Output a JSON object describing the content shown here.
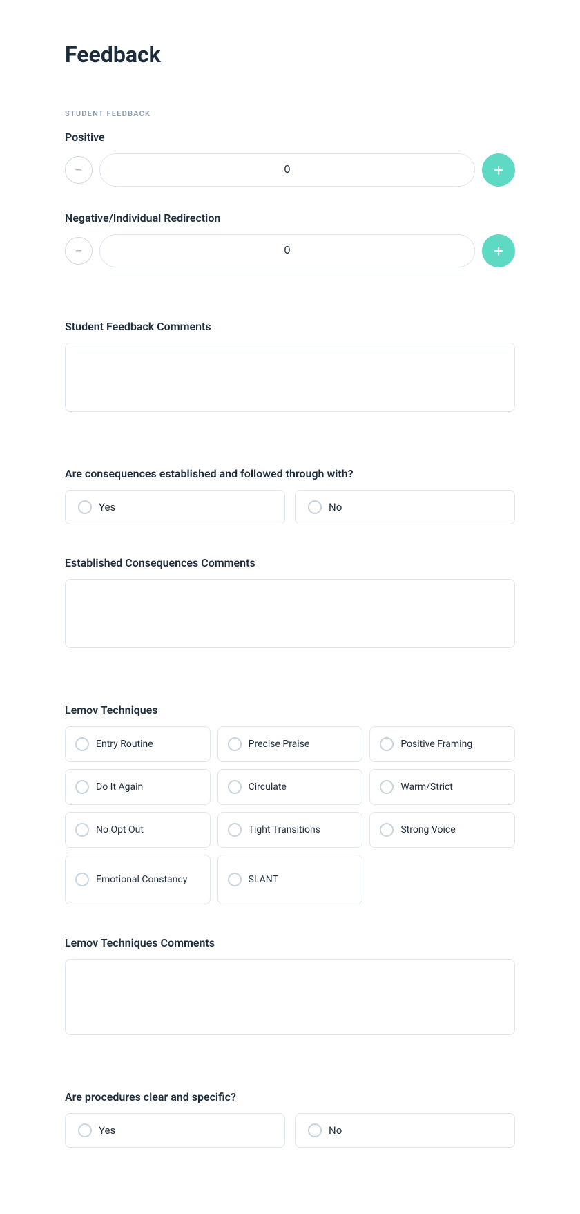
{
  "page": {
    "title": "Feedback"
  },
  "student_feedback_section": {
    "label": "STUDENT FEEDBACK",
    "positive": {
      "label": "Positive",
      "value": "0"
    },
    "negative": {
      "label": "Negative/Individual Redirection",
      "value": "0"
    },
    "comments": {
      "label": "Student Feedback Comments",
      "placeholder": ""
    }
  },
  "consequences_section": {
    "question": "Are consequences established and followed through with?",
    "yes_label": "Yes",
    "no_label": "No",
    "comments_label": "Established Consequences Comments",
    "comments_placeholder": ""
  },
  "lemov_section": {
    "label": "Lemov Techniques",
    "techniques": [
      {
        "id": "entry-routine",
        "label": "Entry Routine"
      },
      {
        "id": "precise-praise",
        "label": "Precise Praise"
      },
      {
        "id": "positive-framing",
        "label": "Positive Framing"
      },
      {
        "id": "do-it-again",
        "label": "Do It Again"
      },
      {
        "id": "circulate",
        "label": "Circulate"
      },
      {
        "id": "warm-strict",
        "label": "Warm/Strict"
      },
      {
        "id": "no-opt-out",
        "label": "No Opt Out"
      },
      {
        "id": "tight-transitions",
        "label": "Tight Transitions"
      },
      {
        "id": "strong-voice",
        "label": "Strong Voice"
      },
      {
        "id": "emotional-constancy",
        "label": "Emotional Constancy"
      },
      {
        "id": "slant",
        "label": "SLANT"
      }
    ],
    "comments_label": "Lemov Techniques Comments",
    "comments_placeholder": ""
  },
  "procedures_section": {
    "question": "Are procedures clear and specific?",
    "yes_label": "Yes",
    "no_label": "No"
  }
}
